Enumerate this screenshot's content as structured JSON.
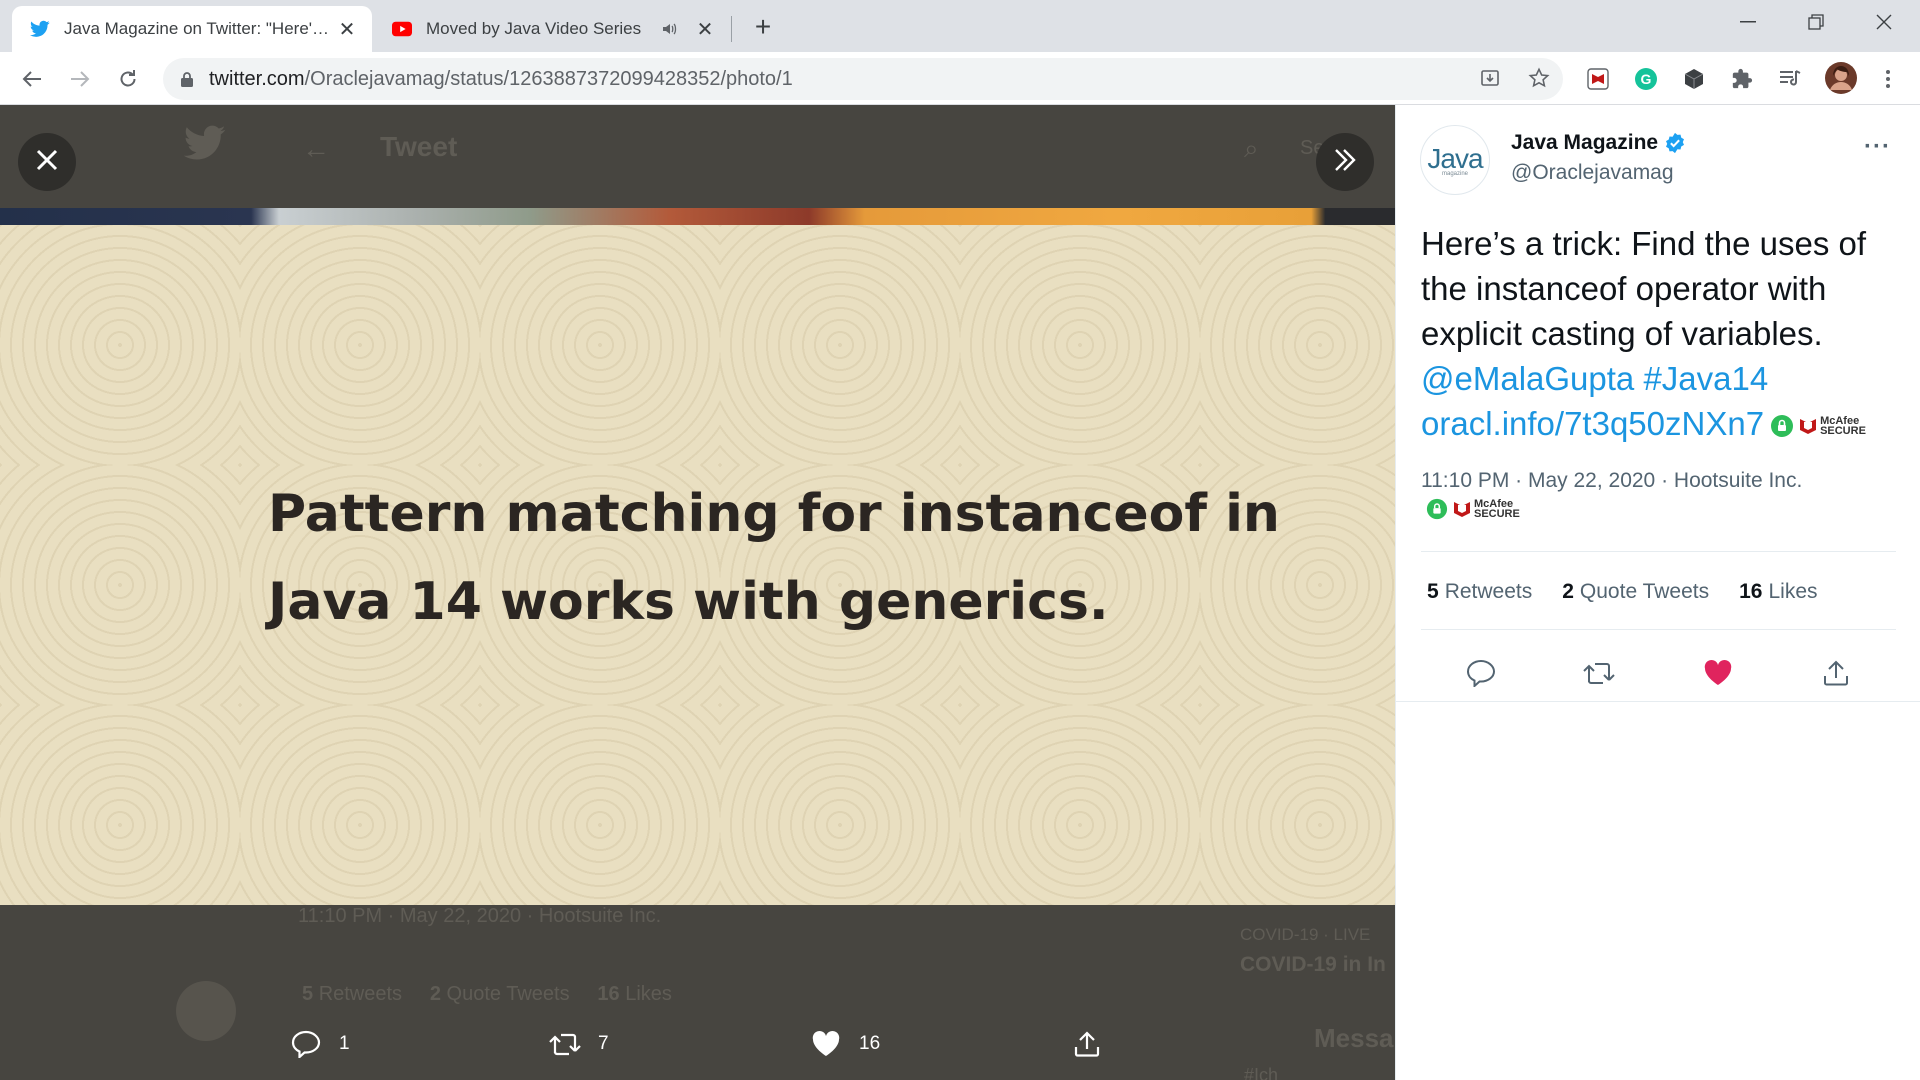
{
  "browser": {
    "tabs": [
      {
        "title": "Java Magazine on Twitter: \"Here's a trick: Find the uses of the instanceof operator with explicit casting of variables.",
        "icon": "twitter-icon",
        "active": true
      },
      {
        "title": "Moved by Java Video Series",
        "icon": "youtube-icon",
        "active": false,
        "audio": true
      }
    ],
    "url_host": "twitter.com",
    "url_path": "/Oraclejavamag/status/1263887372099428352/photo/1"
  },
  "viewer": {
    "ghost_header_title": "Tweet",
    "ghost_search": "Se",
    "poster_line1": "Pattern matching for instanceof in",
    "poster_line2": "Java 14 works with generics.",
    "ghost_meta": "11:10 PM · May 22, 2020 · Hootsuite Inc.",
    "ghost_stats": {
      "retweets": "5",
      "retweets_label": "Retweets",
      "quotes": "2",
      "quotes_label": "Quote Tweets",
      "likes": "16",
      "likes_label": "Likes"
    },
    "ghost_trend_label": "COVID-19 · LIVE",
    "ghost_trend_title": "COVID-19 in In",
    "ghost_messages": "Messa",
    "ghost_hashtag": "#Ich",
    "actions": {
      "replies": "1",
      "retweets": "7",
      "likes": "16"
    }
  },
  "tweet": {
    "author_name": "Java Magazine",
    "author_handle": "@Oraclejavamag",
    "avatar_text": "Java",
    "avatar_sub": "magazine",
    "text_plain": "Here’s a trick: Find the uses of the instanceof operator with explicit casting of variables.",
    "mention": "@eMalaGupta",
    "hashtag": "#Java14",
    "link": "oracl.info/7t3q50zNXn7",
    "meta": "11:10 PM · May 22, 2020 · Hootsuite Inc.",
    "mcafee_line1": "McAfee",
    "mcafee_line2": "SECURE",
    "stats": {
      "retweets": "5",
      "retweets_label": "Retweets",
      "quotes": "2",
      "quotes_label": "Quote Tweets",
      "likes": "16",
      "likes_label": "Likes"
    },
    "colors": {
      "link": "#1b95e0",
      "like": "#e0245e",
      "verified": "#1da1f2"
    }
  }
}
